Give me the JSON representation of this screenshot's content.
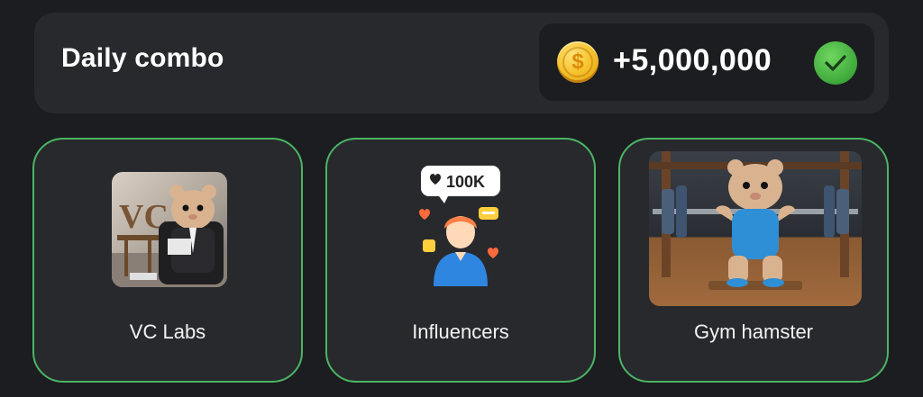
{
  "header": {
    "title": "Daily combo",
    "reward": "+5,000,000",
    "coin_symbol": "$"
  },
  "cards": [
    {
      "label": "VC Labs",
      "image_icon": "hamster-vc-icon"
    },
    {
      "label": "Influencers",
      "image_icon": "influencer-icon",
      "like_count": "100K"
    },
    {
      "label": "Gym hamster",
      "image_icon": "gym-hamster-icon"
    }
  ],
  "colors": {
    "background": "#1c1d20",
    "panel": "#27292d",
    "card_border": "#4bb564",
    "check": "#3ea83b",
    "coin": "#f7c531"
  }
}
